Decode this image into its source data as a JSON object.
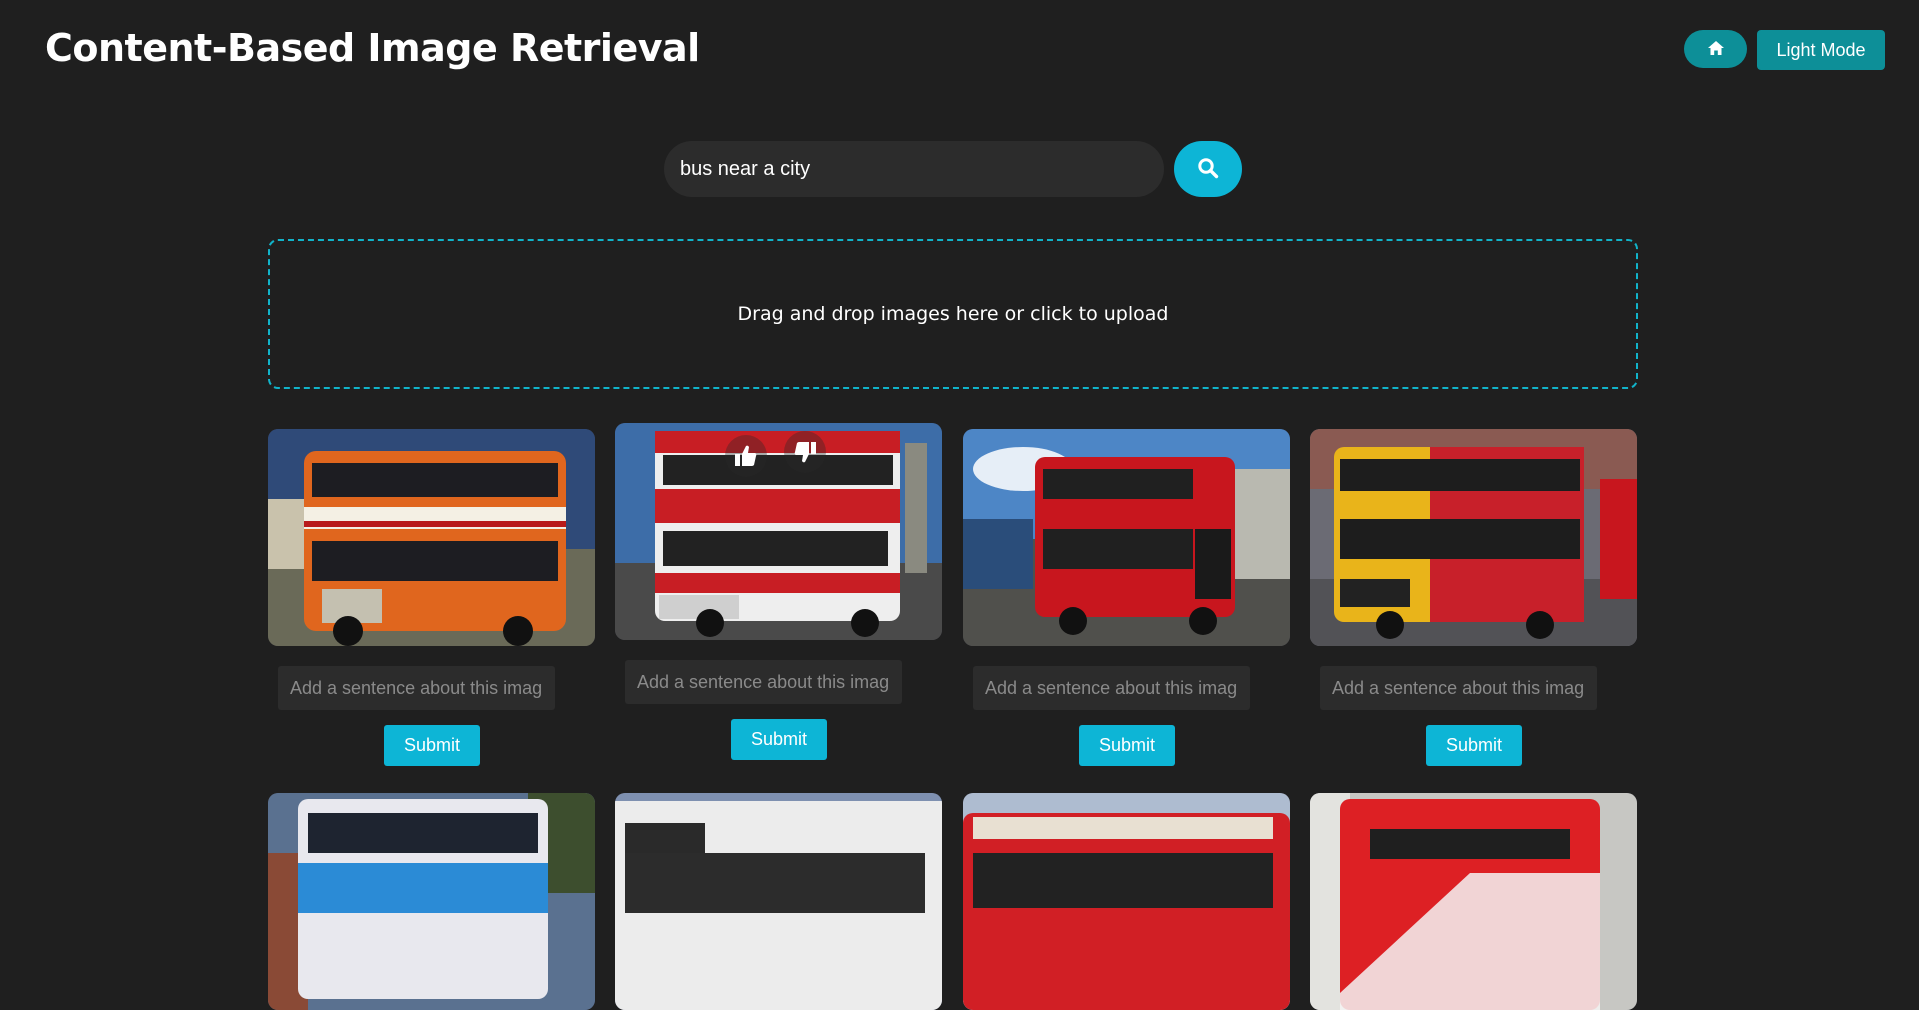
{
  "header": {
    "title": "Content-Based Image Retrieval",
    "mode_label": "Light Mode"
  },
  "search": {
    "value": "bus near a city"
  },
  "upload": {
    "text": "Drag and drop images here or click to upload"
  },
  "results": {
    "caption_placeholder": "Add a sentence about this imag",
    "submit_label": "Submit"
  },
  "colors": {
    "accent": "#0db5d6",
    "accent_dark": "#0d8f98",
    "background": "#1f1f1f",
    "field": "#2c2c2c"
  },
  "icons": [
    "home-icon",
    "search-icon",
    "thumbs-up-icon",
    "thumbs-down-icon"
  ]
}
